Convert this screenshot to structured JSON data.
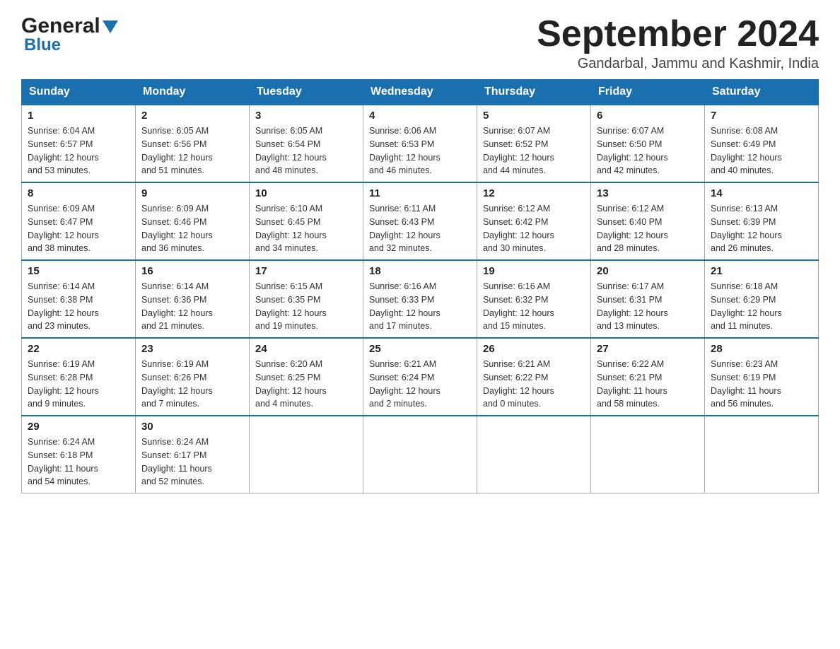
{
  "logo": {
    "general": "General",
    "blue": "Blue"
  },
  "title": {
    "month_year": "September 2024",
    "location": "Gandarbal, Jammu and Kashmir, India"
  },
  "weekdays": [
    "Sunday",
    "Monday",
    "Tuesday",
    "Wednesday",
    "Thursday",
    "Friday",
    "Saturday"
  ],
  "weeks": [
    [
      {
        "day": "1",
        "sunrise": "6:04 AM",
        "sunset": "6:57 PM",
        "daylight": "12 hours and 53 minutes."
      },
      {
        "day": "2",
        "sunrise": "6:05 AM",
        "sunset": "6:56 PM",
        "daylight": "12 hours and 51 minutes."
      },
      {
        "day": "3",
        "sunrise": "6:05 AM",
        "sunset": "6:54 PM",
        "daylight": "12 hours and 48 minutes."
      },
      {
        "day": "4",
        "sunrise": "6:06 AM",
        "sunset": "6:53 PM",
        "daylight": "12 hours and 46 minutes."
      },
      {
        "day": "5",
        "sunrise": "6:07 AM",
        "sunset": "6:52 PM",
        "daylight": "12 hours and 44 minutes."
      },
      {
        "day": "6",
        "sunrise": "6:07 AM",
        "sunset": "6:50 PM",
        "daylight": "12 hours and 42 minutes."
      },
      {
        "day": "7",
        "sunrise": "6:08 AM",
        "sunset": "6:49 PM",
        "daylight": "12 hours and 40 minutes."
      }
    ],
    [
      {
        "day": "8",
        "sunrise": "6:09 AM",
        "sunset": "6:47 PM",
        "daylight": "12 hours and 38 minutes."
      },
      {
        "day": "9",
        "sunrise": "6:09 AM",
        "sunset": "6:46 PM",
        "daylight": "12 hours and 36 minutes."
      },
      {
        "day": "10",
        "sunrise": "6:10 AM",
        "sunset": "6:45 PM",
        "daylight": "12 hours and 34 minutes."
      },
      {
        "day": "11",
        "sunrise": "6:11 AM",
        "sunset": "6:43 PM",
        "daylight": "12 hours and 32 minutes."
      },
      {
        "day": "12",
        "sunrise": "6:12 AM",
        "sunset": "6:42 PM",
        "daylight": "12 hours and 30 minutes."
      },
      {
        "day": "13",
        "sunrise": "6:12 AM",
        "sunset": "6:40 PM",
        "daylight": "12 hours and 28 minutes."
      },
      {
        "day": "14",
        "sunrise": "6:13 AM",
        "sunset": "6:39 PM",
        "daylight": "12 hours and 26 minutes."
      }
    ],
    [
      {
        "day": "15",
        "sunrise": "6:14 AM",
        "sunset": "6:38 PM",
        "daylight": "12 hours and 23 minutes."
      },
      {
        "day": "16",
        "sunrise": "6:14 AM",
        "sunset": "6:36 PM",
        "daylight": "12 hours and 21 minutes."
      },
      {
        "day": "17",
        "sunrise": "6:15 AM",
        "sunset": "6:35 PM",
        "daylight": "12 hours and 19 minutes."
      },
      {
        "day": "18",
        "sunrise": "6:16 AM",
        "sunset": "6:33 PM",
        "daylight": "12 hours and 17 minutes."
      },
      {
        "day": "19",
        "sunrise": "6:16 AM",
        "sunset": "6:32 PM",
        "daylight": "12 hours and 15 minutes."
      },
      {
        "day": "20",
        "sunrise": "6:17 AM",
        "sunset": "6:31 PM",
        "daylight": "12 hours and 13 minutes."
      },
      {
        "day": "21",
        "sunrise": "6:18 AM",
        "sunset": "6:29 PM",
        "daylight": "12 hours and 11 minutes."
      }
    ],
    [
      {
        "day": "22",
        "sunrise": "6:19 AM",
        "sunset": "6:28 PM",
        "daylight": "12 hours and 9 minutes."
      },
      {
        "day": "23",
        "sunrise": "6:19 AM",
        "sunset": "6:26 PM",
        "daylight": "12 hours and 7 minutes."
      },
      {
        "day": "24",
        "sunrise": "6:20 AM",
        "sunset": "6:25 PM",
        "daylight": "12 hours and 4 minutes."
      },
      {
        "day": "25",
        "sunrise": "6:21 AM",
        "sunset": "6:24 PM",
        "daylight": "12 hours and 2 minutes."
      },
      {
        "day": "26",
        "sunrise": "6:21 AM",
        "sunset": "6:22 PM",
        "daylight": "12 hours and 0 minutes."
      },
      {
        "day": "27",
        "sunrise": "6:22 AM",
        "sunset": "6:21 PM",
        "daylight": "11 hours and 58 minutes."
      },
      {
        "day": "28",
        "sunrise": "6:23 AM",
        "sunset": "6:19 PM",
        "daylight": "11 hours and 56 minutes."
      }
    ],
    [
      {
        "day": "29",
        "sunrise": "6:24 AM",
        "sunset": "6:18 PM",
        "daylight": "11 hours and 54 minutes."
      },
      {
        "day": "30",
        "sunrise": "6:24 AM",
        "sunset": "6:17 PM",
        "daylight": "11 hours and 52 minutes."
      },
      null,
      null,
      null,
      null,
      null
    ]
  ],
  "labels": {
    "sunrise": "Sunrise:",
    "sunset": "Sunset:",
    "daylight": "Daylight:"
  }
}
